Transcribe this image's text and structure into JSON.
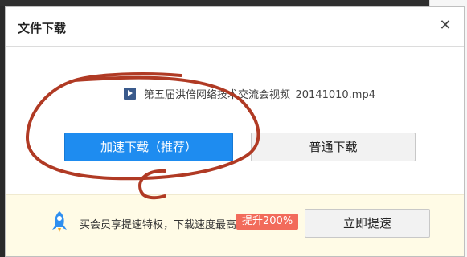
{
  "dialog": {
    "title": "文件下载",
    "close_icon": "close-icon"
  },
  "file": {
    "icon": "video-file-icon",
    "name": "第五届洪倍网络技术交流会视频_20141010.mp4"
  },
  "buttons": {
    "fast_download": "加速下载（推荐）",
    "normal_download": "普通下载"
  },
  "promo": {
    "icon": "rocket-icon",
    "text": "买会员享提速特权，下载速度最高",
    "badge": "提升200%",
    "speed_up_button": "立即提速"
  },
  "colors": {
    "primary_button": "#1e8cf0",
    "badge": "#f26b5b",
    "promo_background": "#fffbe6",
    "annotation_stroke": "#b03a24"
  }
}
